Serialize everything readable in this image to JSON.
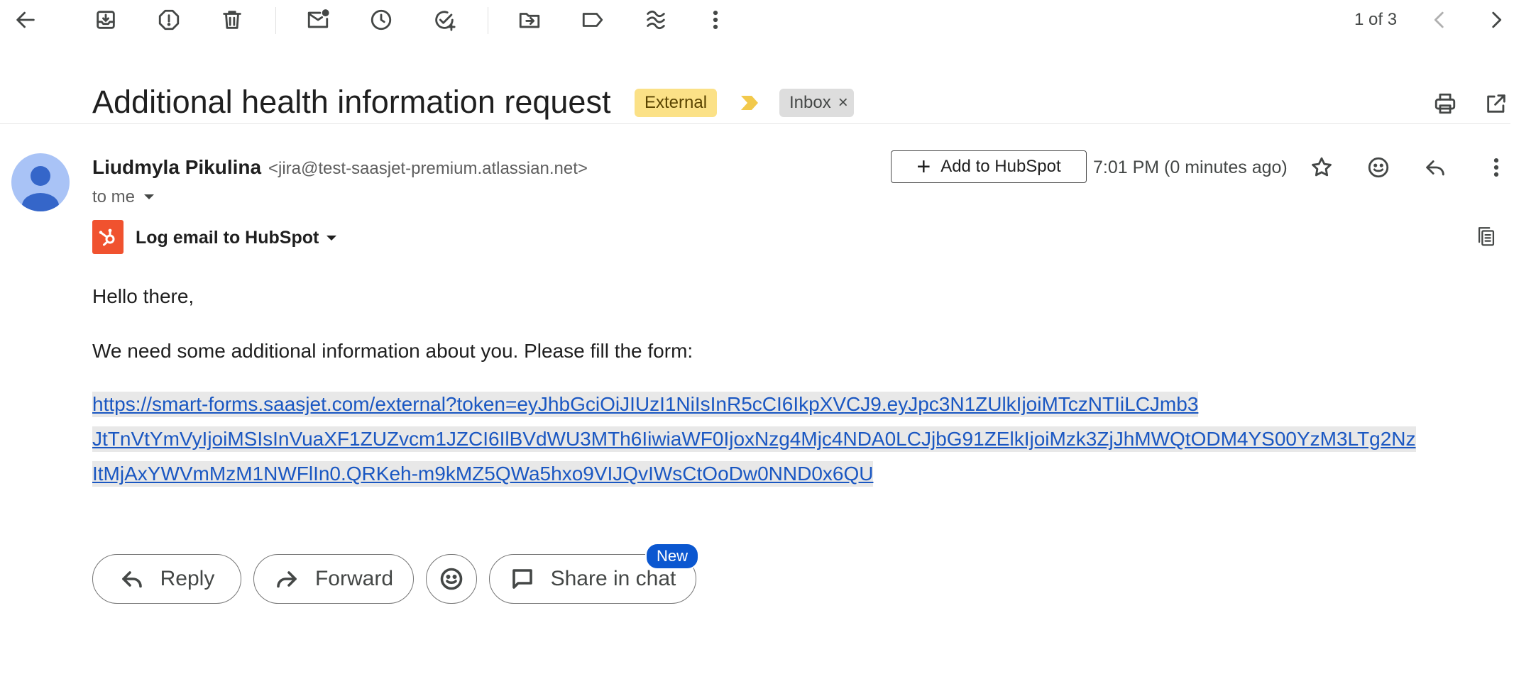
{
  "toolbar": {
    "pager_text": "1 of 3"
  },
  "subject": {
    "title": "Additional health information request",
    "labels": {
      "external": "External",
      "inbox": "Inbox",
      "remove_label": "×"
    }
  },
  "message": {
    "sender_name": "Liudmyla Pikulina",
    "sender_email": "<jira@test-saasjet-premium.atlassian.net>",
    "recipient": "to me",
    "timestamp": "7:01 PM (0 minutes ago)"
  },
  "hubspot": {
    "add_label": "Add to HubSpot",
    "log_label": "Log email to HubSpot",
    "brand_color": "#f0522f"
  },
  "body": {
    "greeting": "Hello there,",
    "paragraph": "We need some additional information about you. Please fill the form:",
    "link_lines": [
      " https://smart-forms.saasjet.com/external?token=eyJhbGciOiJIUzI1NiIsInR5cCI6IkpXVCJ9.eyJpc3N1ZUlkIjoiMTczNTIiLCJmb3",
      "JtTnVtYmVyIjoiMSIsInVuaXF1ZUZvcm1JZCI6IlBVdWU3MTh6IiwiaWF0IjoxNzg4Mjc4NDA0LCJjbG91ZElkIjoiMzk3ZjJhMWQtODM4YS00YzM3LTg2Nz",
      "ItMjAxYWVmMzM1NWFlIn0.QRKeh-m9kMZ5QWa5hxo9VIJQvIWsCtOoDw0NND0x6QU "
    ]
  },
  "actions": {
    "reply": "Reply",
    "forward": "Forward",
    "share_in_chat": "Share in chat",
    "new_badge": "New"
  },
  "colors": {
    "accent": "#0b57d0",
    "link": "#1a57c2",
    "external_label_bg": "#fbe187"
  }
}
